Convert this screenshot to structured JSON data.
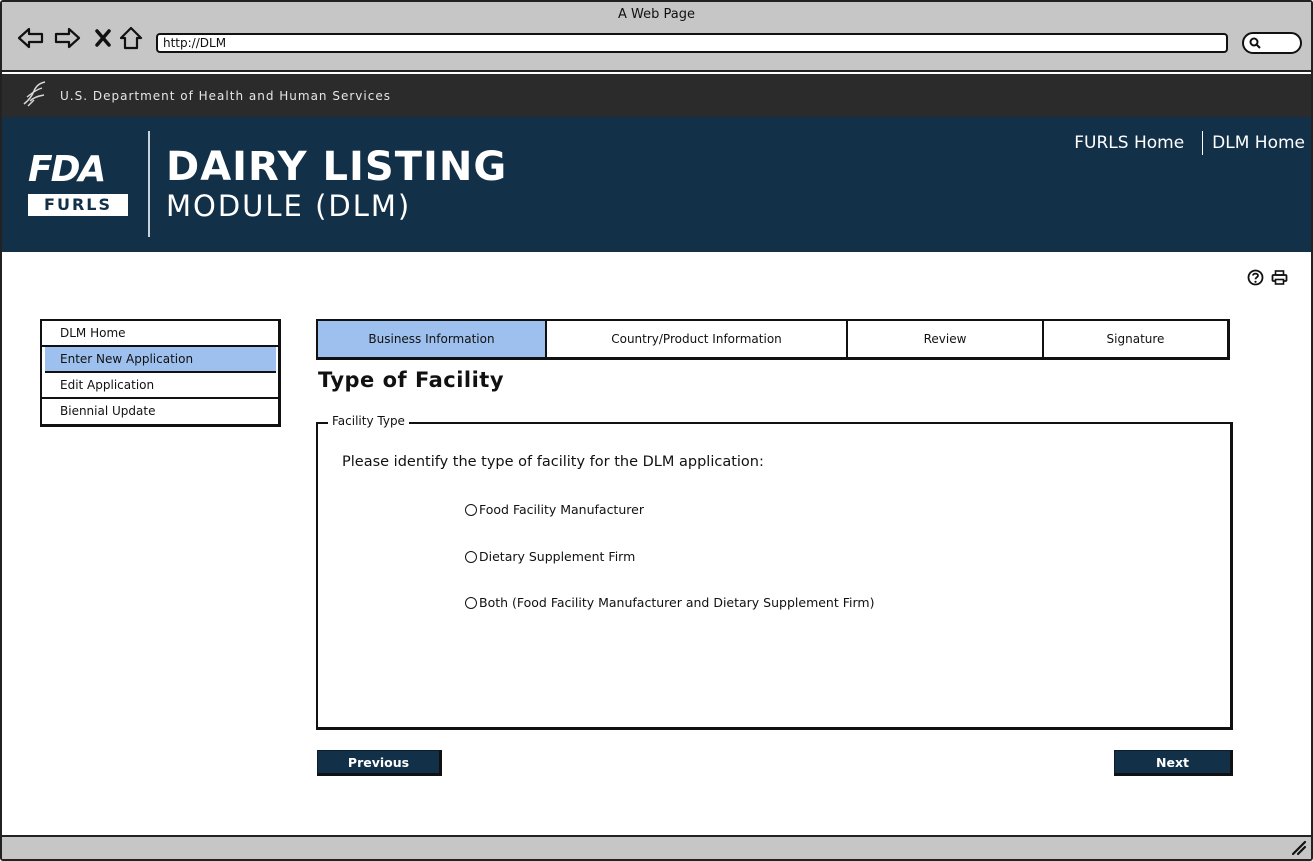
{
  "browser": {
    "title": "A Web Page",
    "url": "http://DLM"
  },
  "gov_banner": {
    "text": "U.S. Department of Health and Human Services"
  },
  "header": {
    "logo_mark": "FDA",
    "logo_badge": "FURLS",
    "title": "DAIRY LISTING",
    "subtitle": "MODULE (DLM)",
    "links": [
      "FURLS Home",
      "DLM Home"
    ]
  },
  "sidebar": {
    "items": [
      {
        "label": "DLM Home",
        "active": false
      },
      {
        "label": "Enter New Application",
        "active": true
      },
      {
        "label": "Edit Application",
        "active": false
      },
      {
        "label": "Biennial Update",
        "active": false
      }
    ]
  },
  "tabs": [
    {
      "label": "Business Information",
      "active": true
    },
    {
      "label": "Country/Product Information",
      "active": false
    },
    {
      "label": "Review",
      "active": false
    },
    {
      "label": "Signature",
      "active": false
    }
  ],
  "main": {
    "heading": "Type of Facility",
    "fieldset_legend": "Facility Type",
    "prompt": "Please identify the type of facility for the DLM application:",
    "options": [
      "Food Facility Manufacturer",
      "Dietary Supplement Firm",
      "Both (Food Facility Manufacturer and Dietary Supplement Firm)"
    ]
  },
  "buttons": {
    "previous": "Previous",
    "next": "Next"
  },
  "icons": {
    "help": "help-icon",
    "print": "print-icon"
  },
  "colors": {
    "header_bg": "#133049",
    "gov_bar_bg": "#2b2b2b",
    "active_highlight": "#9ec0ee",
    "button_bg": "#133049"
  }
}
